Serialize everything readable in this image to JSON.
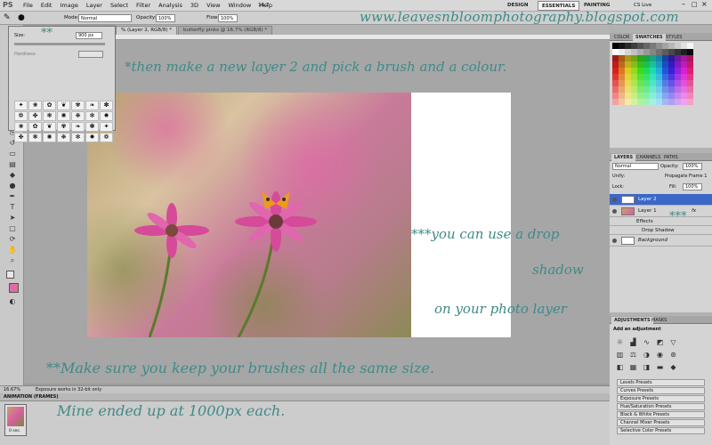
{
  "menubar": {
    "app_icon": "PS",
    "items": [
      "File",
      "Edit",
      "Image",
      "Layer",
      "Select",
      "Filter",
      "Analysis",
      "3D",
      "View",
      "Window",
      "Help"
    ],
    "zoom": "16.7",
    "workspaces": [
      "DESIGN",
      "ESSENTIALS",
      "PAINTING"
    ],
    "cs_live": "CS Live"
  },
  "options": {
    "mode_label": "Mode:",
    "mode_value": "Normal",
    "opacity_label": "Opacity:",
    "opacity_value": "100%",
    "flow_label": "Flow:",
    "flow_value": "100%"
  },
  "doc_tabs": [
    "% (Layer 2, RGB/8) *",
    "butterfly pinks @ 16.7% (RGB/8) *"
  ],
  "brush_panel": {
    "size_label": "Size:",
    "size_value": "900 px",
    "hardness_label": "Hardness:",
    "presets": [
      "675",
      "675",
      "675",
      "675",
      "675",
      "675",
      "675"
    ]
  },
  "status": {
    "zoom": "16.67%",
    "message": "Exposure works in 32-bit only"
  },
  "animation": {
    "title": "ANIMATION (FRAMES)",
    "frame_time": "0 sec."
  },
  "right_panels": {
    "color_tabs": [
      "COLOR",
      "SWATCHES",
      "STYLES"
    ],
    "layers_tabs": [
      "LAYERS",
      "CHANNELS",
      "PATHS"
    ],
    "blend_mode": "Normal",
    "opacity_label": "Opacity:",
    "opacity_value": "100%",
    "unify_label": "Unify:",
    "propagate_label": "Propagate Frame 1",
    "lock_label": "Lock:",
    "fill_label": "Fill:",
    "fill_value": "100%",
    "layers": [
      {
        "name": "Layer 2",
        "selected": true
      },
      {
        "name": "Layer 1",
        "fx": "fx"
      },
      {
        "name": "Effects",
        "sub": true
      },
      {
        "name": "Drop Shadow",
        "sub": true
      },
      {
        "name": "Background",
        "italic": true
      }
    ],
    "adj_tabs": [
      "ADJUSTMENTS",
      "MASKS"
    ],
    "adj_title": "Add an adjustment",
    "presets": [
      "Levels Presets",
      "Curves Presets",
      "Exposure Presets",
      "Hue/Saturation Presets",
      "Black & White Presets",
      "Channel Mixer Presets",
      "Selective Color Presets"
    ]
  },
  "annotations": {
    "url": "www.leavesnbloomphotography.blogspot.com",
    "step1": "*then make a new layer 2 and pick a brush and a colour.",
    "stars2": "**",
    "stars3": "***",
    "drop_line1": "***you can use a drop",
    "drop_line2": "shadow",
    "drop_line3": "on your photo layer",
    "brush_line1": "**Make sure you keep your brushes all the same size.",
    "brush_line2": "Mine ended up at 1000px each."
  },
  "colors": {
    "annotation": "#3f8a88",
    "layer_selected": "#3b67c8",
    "foreground_swatch": "#e06aa6"
  }
}
